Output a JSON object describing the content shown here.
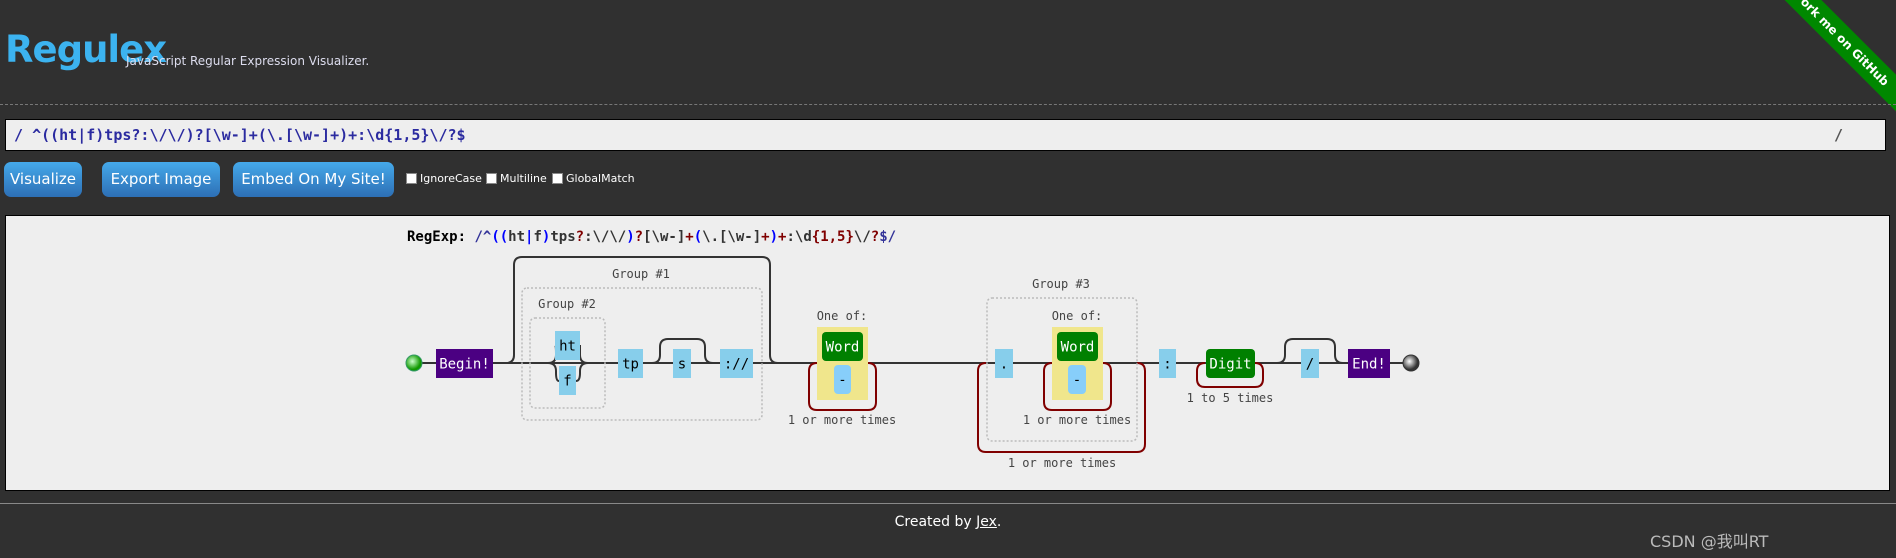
{
  "header": {
    "title": "Regulex",
    "subtitle": "JavaScript Regular Expression Visualizer.",
    "ribbon": "Fork me on GitHub"
  },
  "input": {
    "prefix": "/",
    "value": "^((ht|f)tps?:\\/\\/)?[\\w-]+(\\.[\\w-]+)+:\\d{1,5}\\/?$",
    "suffix": "/"
  },
  "toolbar": {
    "visualize": "Visualize",
    "export": "Export Image",
    "embed": "Embed On My Site!",
    "flags": [
      {
        "label": "IgnoreCase",
        "checked": false
      },
      {
        "label": "Multiline",
        "checked": false
      },
      {
        "label": "GlobalMatch",
        "checked": false
      }
    ]
  },
  "diagram": {
    "regexp_label": "RegExp:",
    "regexp_segments": [
      {
        "t": "/^",
        "c": "#333399"
      },
      {
        "t": "((",
        "c": "#0000ff"
      },
      {
        "t": "ht",
        "c": "#333"
      },
      {
        "t": "|",
        "c": "#0000ff"
      },
      {
        "t": "f",
        "c": "#333"
      },
      {
        "t": ")",
        "c": "#0000ff"
      },
      {
        "t": "tps",
        "c": "#333"
      },
      {
        "t": "?",
        "c": "#800000"
      },
      {
        "t": ":\\/\\/",
        "c": "#333"
      },
      {
        "t": ")",
        "c": "#0000ff"
      },
      {
        "t": "?",
        "c": "#800000"
      },
      {
        "t": "[\\w-]",
        "c": "#333"
      },
      {
        "t": "+",
        "c": "#800000"
      },
      {
        "t": "(",
        "c": "#0000ff"
      },
      {
        "t": "\\.[\\w-]",
        "c": "#333"
      },
      {
        "t": "+",
        "c": "#800000"
      },
      {
        "t": ")",
        "c": "#0000ff"
      },
      {
        "t": "+",
        "c": "#800000"
      },
      {
        "t": ":\\d",
        "c": "#333"
      },
      {
        "t": "{1,5}",
        "c": "#800000"
      },
      {
        "t": "\\/",
        "c": "#333"
      },
      {
        "t": "?",
        "c": "#800000"
      },
      {
        "t": "$/",
        "c": "#333399"
      }
    ],
    "group1": "Group #1",
    "group2": "Group #2",
    "group3": "Group #3",
    "begin": "Begin!",
    "end": "End!",
    "ht": "ht",
    "f": "f",
    "tp": "tp",
    "s": "s",
    "slashes": "://",
    "one_of": "One of:",
    "word": "Word",
    "dash": "-",
    "dot": ".",
    "colon": ":",
    "digit": "Digit",
    "slash": "/",
    "rep1": "1 or more times",
    "rep2": "1 or more times",
    "rep3": "1 or more times",
    "rep4": "1 to 5 times",
    "colors": {
      "literal": "#87ceeb",
      "anchor": "#4b0082",
      "charclass": "#008000",
      "set": "#f0e68c",
      "repeat": "#800000"
    }
  },
  "footer": {
    "created_by": "Created by ",
    "author": "Jex",
    "period": ".",
    "watermark": "CSDN @我叫RT"
  }
}
